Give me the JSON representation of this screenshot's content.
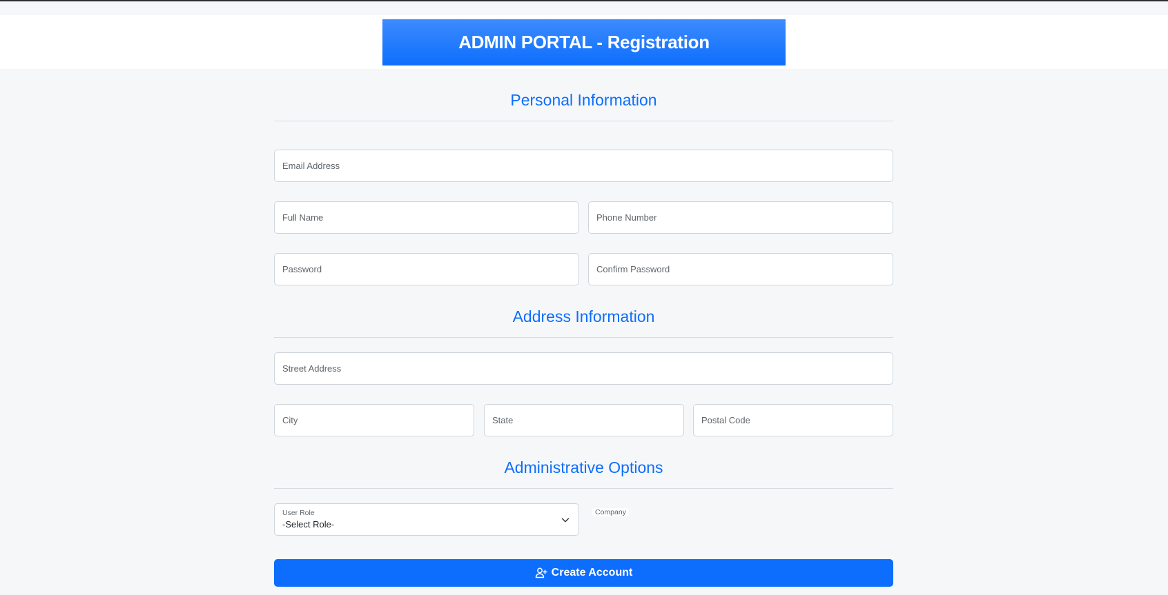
{
  "header": {
    "title": "ADMIN PORTAL - Registration"
  },
  "sections": {
    "personal": "Personal Information",
    "address": "Address Information",
    "admin": "Administrative Options"
  },
  "fields": {
    "email": {
      "placeholder": "Email Address",
      "value": ""
    },
    "full_name": {
      "placeholder": "Full Name",
      "value": ""
    },
    "phone": {
      "placeholder": "Phone Number",
      "value": ""
    },
    "password": {
      "placeholder": "Password",
      "value": ""
    },
    "confirm_password": {
      "placeholder": "Confirm Password",
      "value": ""
    },
    "street": {
      "placeholder": "Street Address",
      "value": ""
    },
    "city": {
      "placeholder": "City",
      "value": ""
    },
    "state": {
      "placeholder": "State",
      "value": ""
    },
    "postal_code": {
      "placeholder": "Postal Code",
      "value": ""
    }
  },
  "user_role": {
    "label": "User Role",
    "selected": "-Select Role-",
    "icon": "chevron-down-icon"
  },
  "company": {
    "label": "Company"
  },
  "submit": {
    "label": "Create Account",
    "icon": "person-add-icon"
  },
  "colors": {
    "accent": "#0d6efd",
    "header_gradient_top": "#3d8bfd",
    "page_background": "#f6f7f9",
    "input_border": "#ced4da"
  }
}
